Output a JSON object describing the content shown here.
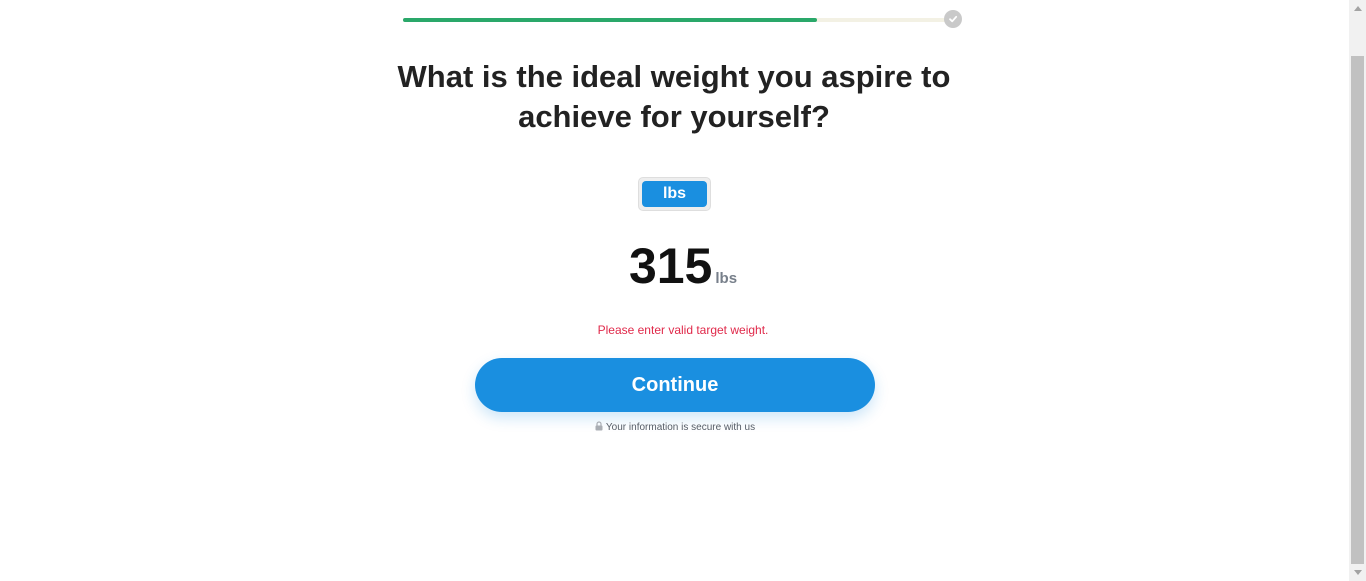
{
  "progress": {
    "fraction": 0.76,
    "track_color": "#f3f1e4",
    "fill_color": "#2aa86a",
    "end_icon": "check-circle-icon"
  },
  "question": {
    "title": "What is the ideal weight you aspire to achieve for yourself?"
  },
  "unit_toggle": {
    "options": [
      "lbs"
    ],
    "selected": "lbs"
  },
  "weight": {
    "value": "315",
    "unit": "lbs"
  },
  "error_message": "Please enter valid target weight.",
  "continue_button": {
    "label": "Continue"
  },
  "secure_note": {
    "icon": "lock-icon",
    "text": "Your information is secure with us"
  },
  "colors": {
    "accent": "#1a8fe0",
    "error": "#e0294a",
    "progress": "#2aa86a"
  }
}
